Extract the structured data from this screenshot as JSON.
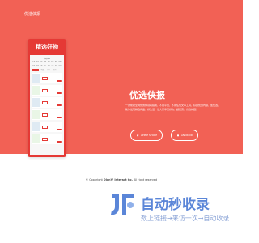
{
  "header": {
    "brand": "优选侠报"
  },
  "phone": {
    "title": "精选好物",
    "screen_title": "优选侠报",
    "categories": [
      "女装",
      "男装",
      "美妆",
      "食品",
      "母婴",
      "鞋包",
      "数码",
      "家居",
      "内衣",
      "配饰",
      "运动",
      "百货",
      "宠物",
      "文娱",
      "车品",
      "更多"
    ],
    "tabs": [
      "综合",
      "销量",
      "价格",
      "折扣"
    ]
  },
  "hero": {
    "title": "优选侠报",
    "description": "一款帮助全网优惠券领取指南，不用平台，不用任何文本工具，好的优惠内容，加优选，助你发现精选商品、好生活，让大家享受好物、超实惠、省钱神器！"
  },
  "buttons": {
    "apple": "APPLE STORE",
    "android": "ANDROID"
  },
  "footer": {
    "prefix": "© Copyright",
    "company": "DianYi Interact Co.",
    "suffix": "All right reserved"
  },
  "watermark": {
    "title": "自动秒收录",
    "subtitle": "数上链接→来访一次→自动收录"
  },
  "colors": {
    "hero": "#f26155",
    "phone": "#e53935",
    "watermark": "#5b86d8"
  },
  "icons": {
    "apple": "apple-icon",
    "android": "android-icon"
  }
}
